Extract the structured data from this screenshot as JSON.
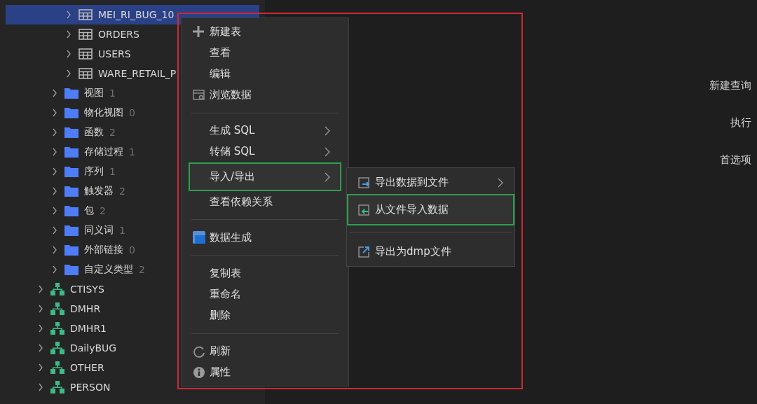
{
  "sidebar": {
    "tree": [
      {
        "kind": "table",
        "label": "MEI_RI_BUG_10",
        "selected": true
      },
      {
        "kind": "table",
        "label": "ORDERS",
        "selected": false
      },
      {
        "kind": "table",
        "label": "USERS",
        "selected": false
      },
      {
        "kind": "table",
        "label": "WARE_RETAIL_P",
        "selected": false
      },
      {
        "kind": "folder",
        "label": "视图",
        "count": "1",
        "selected": false
      },
      {
        "kind": "folder",
        "label": "物化视图",
        "count": "0",
        "selected": false
      },
      {
        "kind": "folder",
        "label": "函数",
        "count": "2",
        "selected": false
      },
      {
        "kind": "folder",
        "label": "存储过程",
        "count": "1",
        "selected": false
      },
      {
        "kind": "folder",
        "label": "序列",
        "count": "1",
        "selected": false
      },
      {
        "kind": "folder",
        "label": "触发器",
        "count": "2",
        "selected": false
      },
      {
        "kind": "folder",
        "label": "包",
        "count": "2",
        "selected": false
      },
      {
        "kind": "folder",
        "label": "同义词",
        "count": "1",
        "selected": false
      },
      {
        "kind": "folder",
        "label": "外部链接",
        "count": "0",
        "selected": false
      },
      {
        "kind": "folder",
        "label": "自定义类型",
        "count": "2",
        "selected": false
      },
      {
        "kind": "schema",
        "label": "CTISYS",
        "selected": false
      },
      {
        "kind": "schema",
        "label": "DMHR",
        "selected": false
      },
      {
        "kind": "schema",
        "label": "DMHR1",
        "selected": false
      },
      {
        "kind": "schema",
        "label": "DailyBUG",
        "selected": false
      },
      {
        "kind": "schema",
        "label": "OTHER",
        "selected": false
      },
      {
        "kind": "schema",
        "label": "PERSON",
        "selected": false
      }
    ]
  },
  "quick_actions": [
    "新建查询",
    "执行",
    "首选项"
  ],
  "context_menu": {
    "groups": [
      [
        {
          "label": "新建表",
          "submenu": false,
          "selected": false
        },
        {
          "label": "查看",
          "submenu": false,
          "selected": false
        },
        {
          "label": "编辑",
          "submenu": false,
          "selected": false
        },
        {
          "label": "浏览数据",
          "submenu": false,
          "selected": false
        }
      ],
      [
        {
          "label": "生成 SQL",
          "submenu": true,
          "selected": false
        },
        {
          "label": "转储 SQL",
          "submenu": true,
          "selected": false
        },
        {
          "label": "导入/导出",
          "submenu": true,
          "selected": true
        },
        {
          "label": "查看依赖关系",
          "submenu": false,
          "selected": false
        }
      ],
      [
        {
          "label": "数据生成",
          "submenu": false,
          "selected": false
        }
      ],
      [
        {
          "label": "复制表",
          "submenu": false,
          "selected": false
        },
        {
          "label": "重命名",
          "submenu": false,
          "selected": false
        },
        {
          "label": "删除",
          "submenu": false,
          "selected": false
        }
      ],
      [
        {
          "label": "刷新",
          "submenu": false,
          "selected": false
        },
        {
          "label": "属性",
          "submenu": false,
          "selected": false
        }
      ]
    ]
  },
  "submenu": {
    "groups": [
      [
        {
          "label": "导出数据到文件",
          "submenu": true,
          "selected": false
        },
        {
          "label": "从文件导入数据",
          "submenu": false,
          "selected": true
        }
      ],
      [
        {
          "label": "导出为dmp文件",
          "submenu": false,
          "selected": false
        }
      ]
    ]
  }
}
